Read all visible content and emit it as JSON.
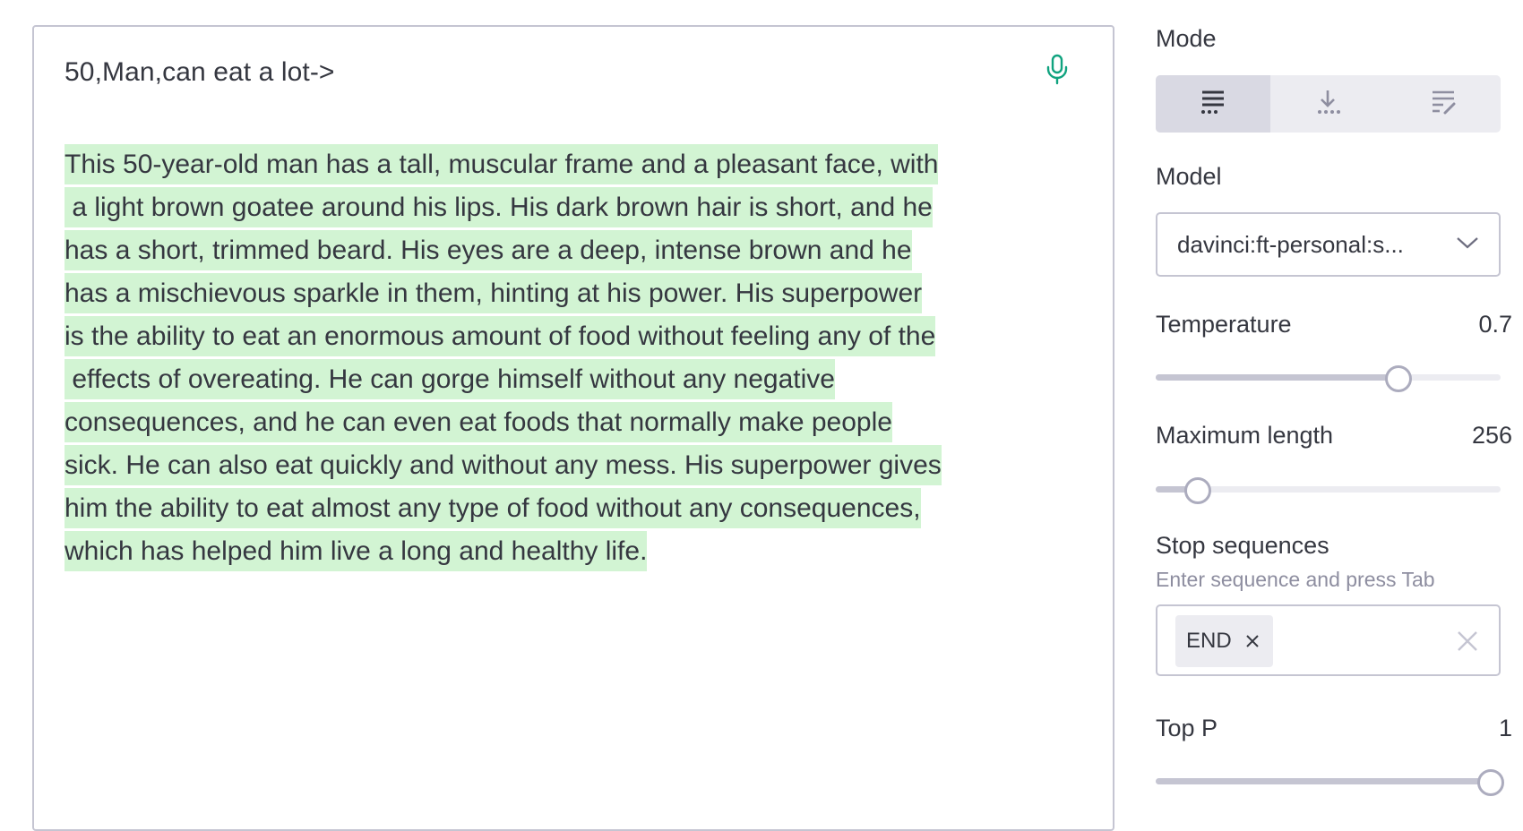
{
  "editor": {
    "prompt": "50,Man,can eat a lot->",
    "completion_lines": [
      "This 50-year-old man has a tall, muscular frame and a pleasant face, with",
      " a light brown goatee around his lips. His dark brown hair is short, and he",
      "has a short, trimmed beard. His eyes are a deep, intense brown and he",
      "has a mischievous sparkle in them, hinting at his power. His superpower",
      "is the ability to eat an enormous amount of food without feeling any of the",
      " effects of overeating. He can gorge himself without any negative",
      "consequences, and he can even eat foods that normally make people",
      "sick. He can also eat quickly and without any mess. His superpower gives",
      "him the ability to eat almost any type of food without any consequences,",
      "which has helped him live a long and healthy life."
    ],
    "mic_icon": "microphone-icon",
    "highlight_color": "#d2f4d3"
  },
  "settings": {
    "mode": {
      "label": "Mode",
      "options": [
        "complete-icon",
        "insert-icon",
        "edit-icon"
      ],
      "selected": "complete-icon"
    },
    "model": {
      "label": "Model",
      "value": "davinci:ft-personal:s...",
      "icon": "chevron-down-icon"
    },
    "temperature": {
      "label": "Temperature",
      "value": "0.7",
      "fraction": 0.7
    },
    "max_length": {
      "label": "Maximum length",
      "value": "256",
      "fraction": 0.12
    },
    "stop_sequences": {
      "label": "Stop sequences",
      "hint": "Enter sequence and press Tab",
      "chips": [
        "END"
      ]
    },
    "top_p": {
      "label": "Top P",
      "value": "1",
      "fraction": 1.0
    }
  }
}
